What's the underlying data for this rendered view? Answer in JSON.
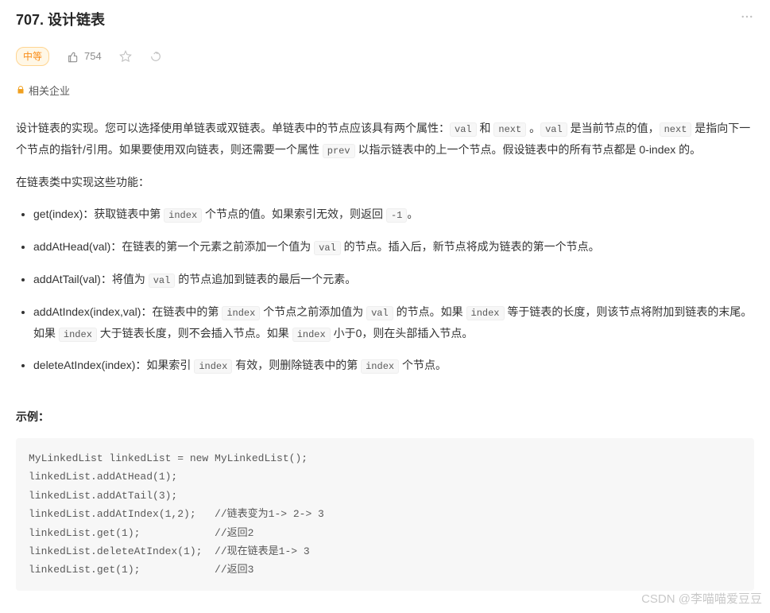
{
  "header": {
    "title": "707. 设计链表"
  },
  "meta": {
    "difficulty": "中等",
    "likes": "754"
  },
  "company": {
    "label": "相关企业"
  },
  "desc": {
    "p1_parts": [
      "设计链表的实现。您可以选择使用单链表或双链表。单链表中的节点应该具有两个属性：",
      "val",
      " 和 ",
      "next",
      " 。",
      "val",
      " 是当前节点的值，",
      "next",
      " 是指向下一个节点的指针/引用。如果要使用双向链表，则还需要一个属性 ",
      "prev",
      " 以指示链表中的上一个节点。假设链表中的所有节点都是 0-index 的。"
    ],
    "p2": "在链表类中实现这些功能："
  },
  "functions": [
    {
      "parts": [
        "get(index)：获取链表中第 ",
        "index",
        " 个节点的值。如果索引无效，则返回 ",
        "-1",
        "。"
      ]
    },
    {
      "parts": [
        "addAtHead(val)：在链表的第一个元素之前添加一个值为 ",
        "val",
        " 的节点。插入后，新节点将成为链表的第一个节点。"
      ]
    },
    {
      "parts": [
        "addAtTail(val)：将值为 ",
        "val",
        " 的节点追加到链表的最后一个元素。"
      ]
    },
    {
      "parts": [
        "addAtIndex(index,val)：在链表中的第 ",
        "index",
        " 个节点之前添加值为 ",
        "val",
        " 的节点。如果 ",
        "index",
        " 等于链表的长度，则该节点将附加到链表的末尾。如果 ",
        "index",
        " 大于链表长度，则不会插入节点。如果 ",
        "index",
        " 小于0，则在头部插入节点。"
      ]
    },
    {
      "parts": [
        "deleteAtIndex(index)：如果索引 ",
        "index",
        " 有效，则删除链表中的第 ",
        "index",
        " 个节点。"
      ]
    }
  ],
  "example": {
    "label": "示例：",
    "code": "MyLinkedList linkedList = new MyLinkedList();\nlinkedList.addAtHead(1);\nlinkedList.addAtTail(3);\nlinkedList.addAtIndex(1,2);   //链表变为1-> 2-> 3\nlinkedList.get(1);            //返回2\nlinkedList.deleteAtIndex(1);  //现在链表是1-> 3\nlinkedList.get(1);            //返回3"
  },
  "watermark": "CSDN @李喵喵爱豆豆"
}
